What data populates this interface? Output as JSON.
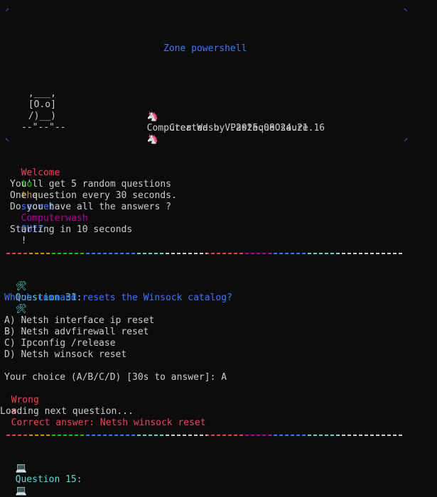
{
  "header": {
    "zone_title": "Zone powershell",
    "ascii_art": [
      " ,___,",
      " [O.o]",
      " /)__)",
      "--\"--\"--"
    ],
    "app_name": "Computer Wash V.2025.08.24.21.16",
    "created_by": "Created by PastequeOsaure"
  },
  "welcome": {
    "words": [
      "Welcome",
      "to",
      "the",
      "secret",
      "Computerwash",
      "QUIZ",
      "!"
    ],
    "colors": [
      "#e74856",
      "#16c60c",
      "#c19c00",
      "#3b78ff",
      "#b4009e",
      "#3b78ff",
      "#cccccc"
    ]
  },
  "intro": {
    "line1": "You'll get 5 random questions",
    "line2": "One question every 30 seconds.",
    "line3": "Do you have all the answers ?",
    "starting": "Starting in 10 seconds"
  },
  "question1": {
    "title": "Question 31:",
    "icon": "hammer-wrench-icon",
    "text": "Which command resets the Winsock catalog?",
    "options": [
      "A) Netsh interface ip reset",
      "B) Netsh advfirewall reset",
      "C) Ipconfig /release",
      "D) Netsh winsock reset"
    ],
    "prompt": "Your choice (A/B/C/D) [30s to answer]: A",
    "result_wrong": "Wrong",
    "result_answer": "Correct answer: Netsh winsock reset",
    "loading": "Loading next question..."
  },
  "question2": {
    "title": "Question 15:",
    "icon": "computer-icon"
  },
  "colors": {
    "background": "#0c0c0c",
    "text": "#cccccc",
    "accent_blue": "#3b78ff",
    "accent_cyan": "#61d6d6",
    "error_red": "#e74856",
    "frame_purple": "#b4009e"
  }
}
